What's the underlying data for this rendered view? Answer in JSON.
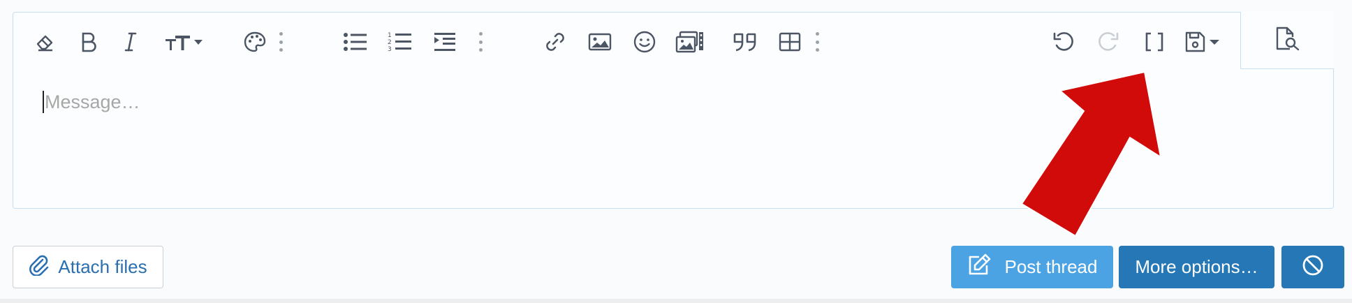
{
  "editor": {
    "placeholder": "Message…",
    "toolbar": {
      "left_groups": [
        [
          "eraser-icon",
          "bold-icon",
          "italic-icon",
          "text-size-icon",
          "palette-icon",
          "more-dots-icon"
        ],
        [
          "bullet-list-icon",
          "numbered-list-icon",
          "indent-icon",
          "more-dots-icon"
        ],
        [
          "link-icon",
          "image-icon",
          "emoji-icon",
          "media-gallery-icon",
          "quote-icon",
          "table-icon",
          "more-dots-icon"
        ]
      ],
      "right_group": [
        "undo-icon",
        "redo-icon",
        "bbcode-brackets-icon",
        "save-draft-icon"
      ],
      "preview": "preview-icon",
      "redo_disabled": true
    }
  },
  "actions": {
    "attach_label": "Attach files",
    "post_label": "Post thread",
    "more_label": "More options…",
    "cancel_icon": "cancel-circle-icon"
  },
  "colors": {
    "primary": "#2577b5",
    "post": "#4ba3e3",
    "link_text": "#2a6fb0",
    "annotation_arrow": "#d10a0a",
    "editor_border": "#c7dff0"
  }
}
